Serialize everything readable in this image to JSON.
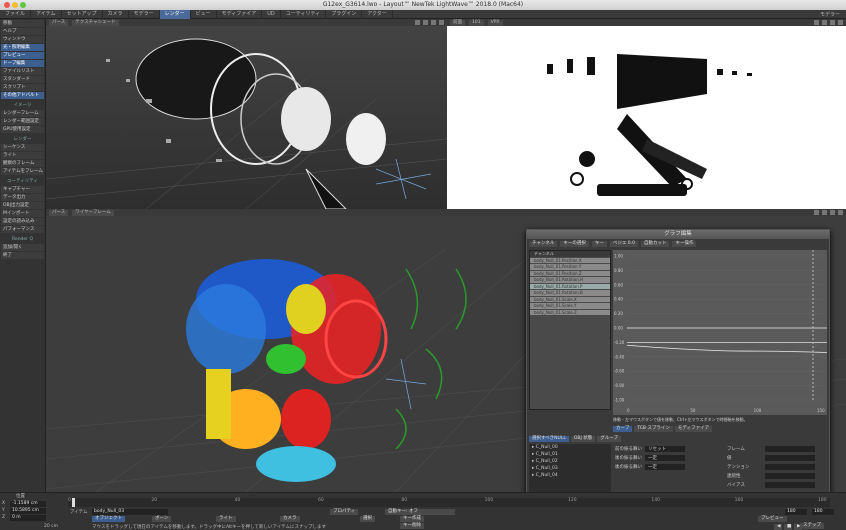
{
  "window": {
    "title": "G12ex_G3614.lwo - Layout™ NewTek LightWave™ 2018.0 (Mac64)"
  },
  "menubar": {
    "tabs": [
      "ファイル",
      "アイテム",
      "セットアップ",
      "カメラ",
      "モデラー",
      "レンダー",
      "ビュー",
      "モディファイア",
      "UD",
      "ユーティリティ",
      "プラグイン",
      "アクター"
    ],
    "active": 5,
    "right": "モデラー"
  },
  "sidebar": {
    "items": [
      {
        "label": "移動",
        "hl": false
      },
      {
        "label": "ヘルプ",
        "hl": false
      },
      {
        "label": "ウィンドウ",
        "hl": false
      },
      {
        "label": "光・照明編集",
        "hl": true
      },
      {
        "label": "プレビュー",
        "hl": true
      },
      {
        "label": "ドープ編集",
        "hl": true
      },
      {
        "label": "ファイルリスト",
        "hl": false
      },
      {
        "label": "スタンダード",
        "hl": false
      },
      {
        "label": "スクリプト",
        "hl": false
      },
      {
        "label": "その他アドバルト",
        "hl": true
      }
    ],
    "sections": [
      {
        "head": "イメージ",
        "items": [
          "レンダーフレーム",
          "レンダー範囲設定",
          "GPU使用設定"
        ]
      },
      {
        "head": "レンダー",
        "items": [
          "シーケンス",
          "ライト",
          "観察のフレーム",
          "アイテムをフレーム"
        ]
      },
      {
        "head": "ユーティリティ",
        "items": [
          "キャプチャー",
          "データ出力",
          "OBJ出力設定",
          "Mインポート",
          "設定の読み込み",
          "パフォーマンス"
        ]
      },
      {
        "head": "Render Q",
        "items": [
          "追加/開く",
          "終了"
        ]
      }
    ]
  },
  "viewports": {
    "top_left": {
      "view": "パース",
      "mode": "テクスチャシェード"
    },
    "top_right": {
      "view": "前面",
      "mode": "101",
      "mode2": "VPR"
    },
    "bottom": {
      "view": "パース",
      "mode": "ワイヤーフレーム"
    }
  },
  "graph_editor": {
    "title": "グラフ編集",
    "toolbar": [
      "チャンネル",
      "キーの選択",
      "キー",
      "ベジエ 0.0",
      "自動カット",
      "キー操作"
    ],
    "list_header": "チャンネル",
    "channels": [
      "body_Null_01.Position.X",
      "body_Null_01.Position.Y",
      "body_Null_01.Position.Z",
      "body_Null_01.Rotation.H",
      "body_Null_01.Rotation.P",
      "body_Null_01.Rotation.B",
      "body_Null_01.Scale.X",
      "body_Null_01.Scale.Y",
      "body_Null_01.Scale.Z"
    ],
    "y_ticks": [
      "1.00",
      "0.80",
      "0.60",
      "0.40",
      "0.20",
      "0.00",
      "-0.20",
      "-0.40",
      "-0.60",
      "-0.80",
      "-1.00"
    ],
    "x_ticks": [
      "0",
      "50",
      "100",
      "150"
    ],
    "status": "移動 - 左マウスボタンで値を移動、Ctrl+左マウスボタンで時間軸を移動。",
    "tabs": [
      "カーブ",
      "TCB スプライン",
      "モディファイア"
    ],
    "bottom_tabs": [
      "選択すべきNULL",
      "OBJ 状態",
      "グループ"
    ],
    "scene_items": [
      "C_Null_00",
      "C_Null_01",
      "C_Null_02",
      "C_Null_03",
      "C_Null_04"
    ],
    "fields": [
      {
        "label": "前の振る舞い",
        "value": "リセット"
      },
      {
        "label": "後の振る舞い",
        "value": "一定"
      },
      {
        "label": "後の振る舞い",
        "value": "一定"
      }
    ],
    "right_fields": [
      "フレーム",
      "値",
      "テンション",
      "連続性",
      "バイアス"
    ]
  },
  "bottom": {
    "position_label": "位置",
    "coords": [
      {
        "axis": "X",
        "value": "-1.1589 cm"
      },
      {
        "axis": "Y",
        "value": "10.5895 cm"
      },
      {
        "axis": "Z",
        "value": "0 m"
      }
    ],
    "grid": "20 cm",
    "item_label": "アイテム",
    "item_value": "body_Null_03",
    "objects_label": "オブジェクト",
    "bones_label": "ボーン",
    "lights_label": "ライト",
    "cameras_label": "カメラ",
    "properties": "プロパティ",
    "autokey": "自動キー: オフ",
    "choose": "選択",
    "create_key": "キー作成",
    "delete_key": "キー削除",
    "preview": "プレビュー",
    "step": "ステップ",
    "hint": "マウスをドラッグして現在のアイテムを移動します。ドラッグ中にAltキーを押して新しいアイテムにスナップします",
    "timeline_ticks": [
      "0",
      "20",
      "40",
      "60",
      "80",
      "100",
      "120",
      "140",
      "160",
      "180"
    ],
    "end_fields": [
      "180",
      "180"
    ]
  }
}
